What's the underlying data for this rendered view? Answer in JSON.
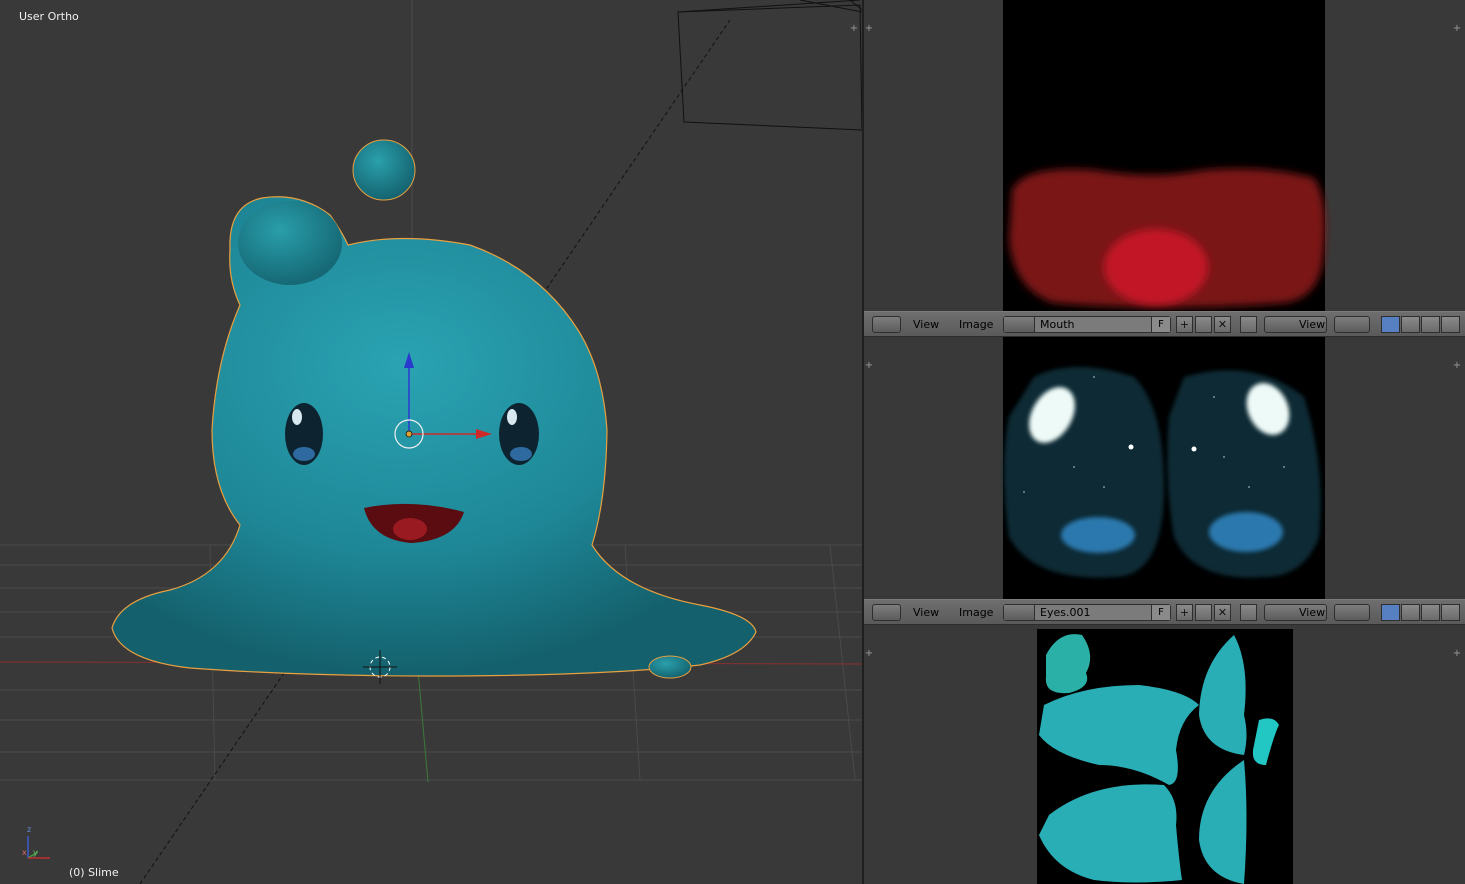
{
  "viewport": {
    "view_label": "User Ortho",
    "object_label": "(0) Slime",
    "axis_labels": {
      "z": "z",
      "y": "y",
      "x": "x"
    }
  },
  "image_editors": [
    {
      "image_name": "Mouth",
      "menu_view": "View",
      "menu_image": "Image",
      "fake_user": "F",
      "view_select": "View"
    },
    {
      "image_name": "Eyes.001",
      "menu_view": "View",
      "menu_image": "Image",
      "fake_user": "F",
      "view_select": "View"
    }
  ],
  "icons": {
    "add": "+",
    "close": "✕",
    "corner": "+"
  },
  "colors": {
    "background": "#393939",
    "slime": "#2b9aa8",
    "selection_outline": "#f0a030",
    "mouth_texture": "#8a1a20",
    "eyes_texture": "#0e2a35",
    "uv_island": "#2aaeb6"
  }
}
